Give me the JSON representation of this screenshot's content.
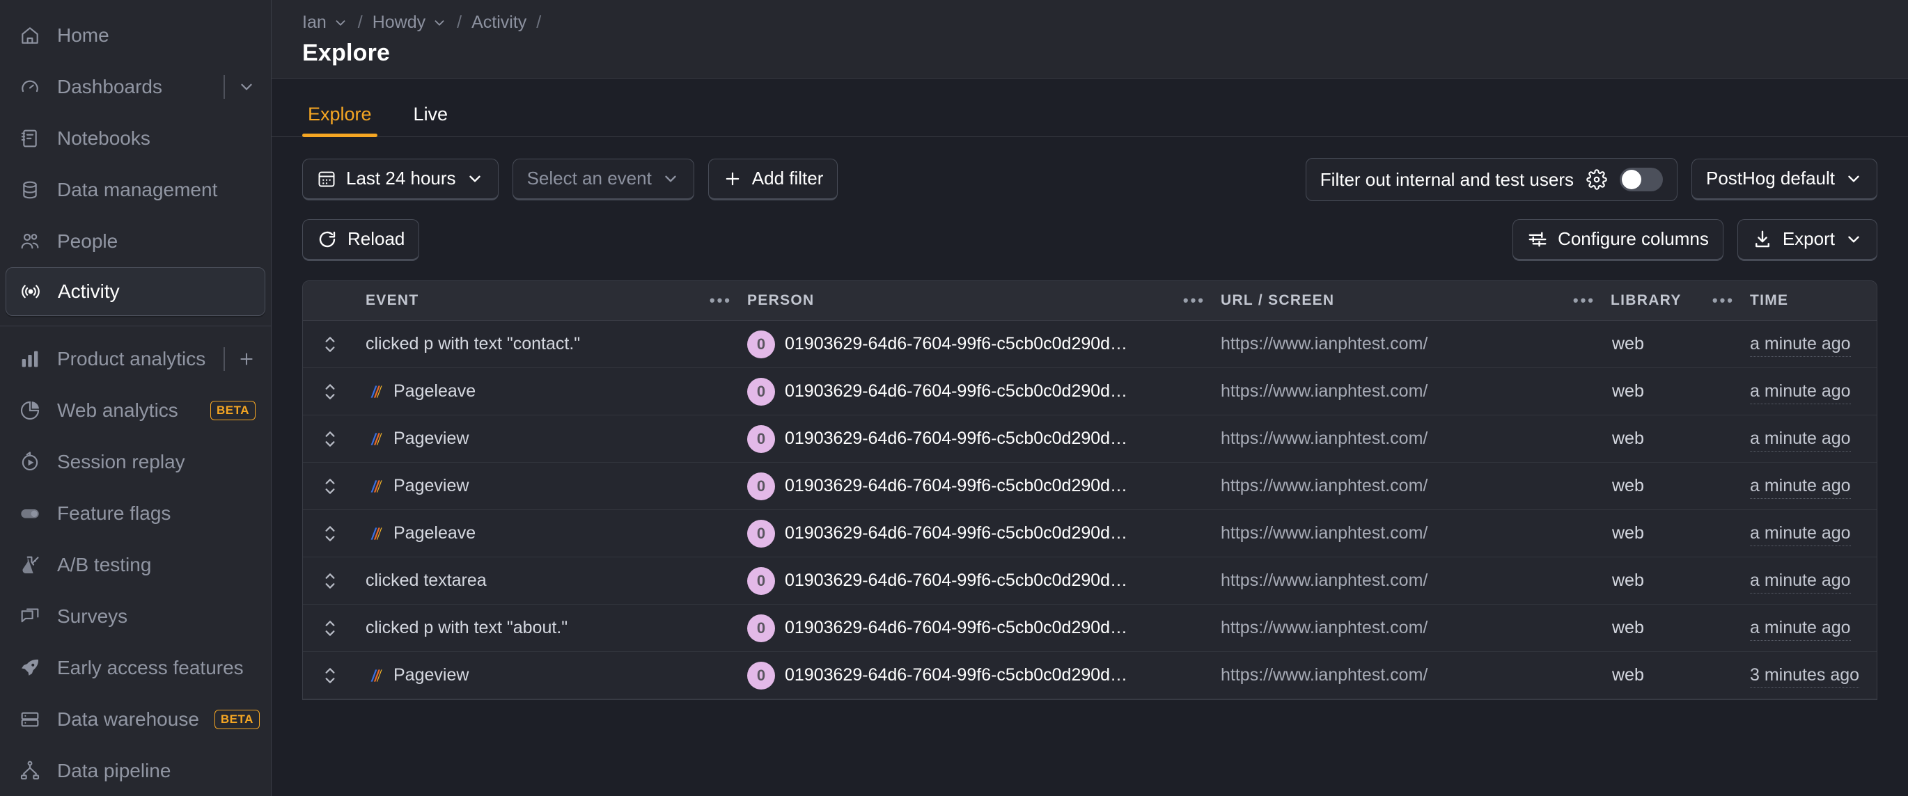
{
  "sidebar": {
    "items": [
      {
        "label": "Home",
        "icon": "home-icon",
        "active": false
      },
      {
        "label": "Dashboards",
        "icon": "dashboard-gauge-icon",
        "active": false,
        "trailing": "chevron-down"
      },
      {
        "label": "Notebooks",
        "icon": "notebook-icon",
        "active": false
      },
      {
        "label": "Data management",
        "icon": "database-icon",
        "active": false
      },
      {
        "label": "People",
        "icon": "people-icon",
        "active": false
      },
      {
        "label": "Activity",
        "icon": "activity-broadcast-icon",
        "active": true
      }
    ],
    "items2": [
      {
        "label": "Product analytics",
        "icon": "bar-chart-icon",
        "trailing": "plus"
      },
      {
        "label": "Web analytics",
        "icon": "pie-chart-icon",
        "badge": "BETA"
      },
      {
        "label": "Session replay",
        "icon": "replay-icon"
      },
      {
        "label": "Feature flags",
        "icon": "toggle-icon"
      },
      {
        "label": "A/B testing",
        "icon": "flask-icon"
      },
      {
        "label": "Surveys",
        "icon": "chat-bubbles-icon"
      },
      {
        "label": "Early access features",
        "icon": "rocket-icon"
      },
      {
        "label": "Data warehouse",
        "icon": "warehouse-icon",
        "badge": "BETA"
      },
      {
        "label": "Data pipeline",
        "icon": "pipeline-icon"
      }
    ]
  },
  "header": {
    "breadcrumb": [
      {
        "label": "Ian",
        "chevron": true
      },
      {
        "label": "Howdy",
        "chevron": true
      },
      {
        "label": "Activity",
        "chevron": false
      }
    ],
    "separator": "/",
    "title": "Explore"
  },
  "tabs": [
    {
      "label": "Explore",
      "active": true
    },
    {
      "label": "Live",
      "active": false
    }
  ],
  "filters": {
    "date_range": "Last 24 hours",
    "event_select": "Select an event",
    "add_filter": "Add filter",
    "internal_users_label": "Filter out internal and test users",
    "internal_users_toggle": "off",
    "project_default": "PostHog default"
  },
  "actions": {
    "reload": "Reload",
    "configure_columns": "Configure columns",
    "export": "Export"
  },
  "table": {
    "columns": [
      {
        "key": "expand",
        "label": "",
        "menu": false
      },
      {
        "key": "event",
        "label": "EVENT",
        "menu": true
      },
      {
        "key": "person",
        "label": "PERSON",
        "menu": true
      },
      {
        "key": "url",
        "label": "URL / SCREEN",
        "menu": true
      },
      {
        "key": "library",
        "label": "LIBRARY",
        "menu": true
      },
      {
        "key": "time",
        "label": "TIME",
        "menu": true
      }
    ],
    "menu_glyph": "•••",
    "rows": [
      {
        "event": "clicked p with text \"contact.\"",
        "has_icon": false,
        "avatar": "0",
        "person": "01903629-64d6-7604-99f6-c5cb0c0d290d…",
        "url": "https://www.ianphtest.com/",
        "library": "web",
        "time": "a minute ago"
      },
      {
        "event": "Pageleave",
        "has_icon": true,
        "avatar": "0",
        "person": "01903629-64d6-7604-99f6-c5cb0c0d290d…",
        "url": "https://www.ianphtest.com/",
        "library": "web",
        "time": "a minute ago"
      },
      {
        "event": "Pageview",
        "has_icon": true,
        "avatar": "0",
        "person": "01903629-64d6-7604-99f6-c5cb0c0d290d…",
        "url": "https://www.ianphtest.com/",
        "library": "web",
        "time": "a minute ago"
      },
      {
        "event": "Pageview",
        "has_icon": true,
        "avatar": "0",
        "person": "01903629-64d6-7604-99f6-c5cb0c0d290d…",
        "url": "https://www.ianphtest.com/",
        "library": "web",
        "time": "a minute ago"
      },
      {
        "event": "Pageleave",
        "has_icon": true,
        "avatar": "0",
        "person": "01903629-64d6-7604-99f6-c5cb0c0d290d…",
        "url": "https://www.ianphtest.com/",
        "library": "web",
        "time": "a minute ago"
      },
      {
        "event": "clicked textarea",
        "has_icon": false,
        "avatar": "0",
        "person": "01903629-64d6-7604-99f6-c5cb0c0d290d…",
        "url": "https://www.ianphtest.com/",
        "library": "web",
        "time": "a minute ago"
      },
      {
        "event": "clicked p with text \"about.\"",
        "has_icon": false,
        "avatar": "0",
        "person": "01903629-64d6-7604-99f6-c5cb0c0d290d…",
        "url": "https://www.ianphtest.com/",
        "library": "web",
        "time": "a minute ago"
      },
      {
        "event": "Pageview",
        "has_icon": true,
        "avatar": "0",
        "person": "01903629-64d6-7604-99f6-c5cb0c0d290d…",
        "url": "https://www.ianphtest.com/",
        "library": "web",
        "time": "3 minutes ago"
      }
    ]
  },
  "colors": {
    "accent": "#f5a623",
    "sidebar_bg": "#26282f",
    "main_bg": "#1d1f27",
    "avatar_bg": "#e3b9e8",
    "beta_badge": "#f5a623"
  }
}
